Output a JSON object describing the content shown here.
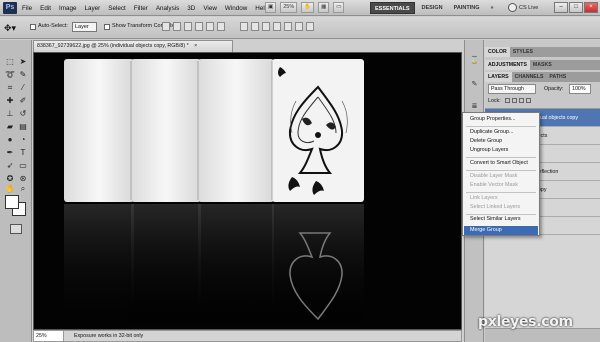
{
  "app": {
    "logo": "Ps"
  },
  "menubar": {
    "menus": [
      "File",
      "Edit",
      "Image",
      "Layer",
      "Select",
      "Filter",
      "Analysis",
      "3D",
      "View",
      "Window",
      "Help"
    ],
    "zoom": "25%",
    "workspaces": {
      "essentials": "ESSENTIALS",
      "design": "DESIGN",
      "painting": "PAINTING",
      "more": "»"
    },
    "cs_live": "CS Live"
  },
  "options": {
    "tool_icon": "move-tool-icon",
    "auto_select_label": "Auto-Select:",
    "auto_select_value": "Layer",
    "show_transform_label": "Show Transform Controls"
  },
  "document": {
    "tab_title": "838367_92739622.jpg @ 25% (individual objects copy, RGB/8) *",
    "tab_close": "×",
    "zoom_field": "25%",
    "status_text": "Exposure works in 32-bit only"
  },
  "panels": {
    "tabs_top": [
      "COLOR",
      "STYLES"
    ],
    "tabs_mid": [
      "ADJUSTMENTS",
      "MASKS"
    ],
    "tabs_layers": [
      "LAYERS",
      "CHANNELS",
      "PATHS"
    ],
    "blend_mode": "Pass Through",
    "opacity_label": "Opacity:",
    "opacity_value": "100%",
    "lock_label": "Lock:",
    "layers": [
      {
        "name": "individual objects copy"
      },
      {
        "name": "al objects"
      },
      {
        "name": "ot"
      },
      {
        "name": "card reflection"
      },
      {
        "name": "and copy"
      },
      {
        "name": "and"
      },
      {
        "name": ""
      }
    ]
  },
  "context_menu": {
    "items": [
      {
        "label": "Group Properties...",
        "enabled": true
      },
      {
        "label": "Duplicate Group...",
        "enabled": true
      },
      {
        "label": "Delete Group",
        "enabled": true
      },
      {
        "label": "Ungroup Layers",
        "enabled": true
      },
      {
        "label": "Convert to Smart Object",
        "enabled": true
      },
      {
        "label": "Disable Layer Mask",
        "enabled": false
      },
      {
        "label": "Enable Vector Mask",
        "enabled": false
      },
      {
        "label": "Link Layers",
        "enabled": false
      },
      {
        "label": "Select Linked Layers",
        "enabled": false
      },
      {
        "label": "Select Similar Layers",
        "enabled": true
      },
      {
        "label": "Merge Group",
        "enabled": true,
        "highlighted": true
      }
    ]
  },
  "watermark": "pxleyes.com",
  "colors": {
    "highlight": "#3c6ab3",
    "selected_layer": "#4f76b3",
    "canvas_bg": "#030303"
  }
}
